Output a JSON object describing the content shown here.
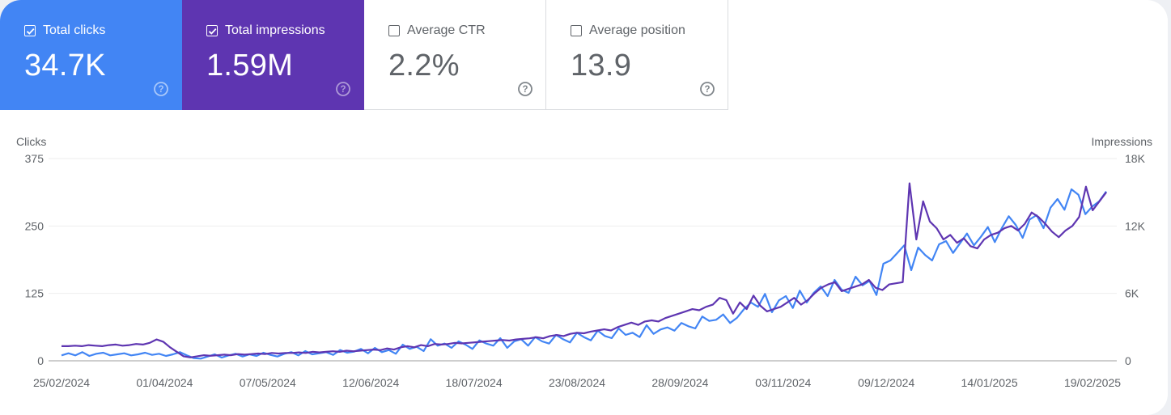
{
  "metrics": [
    {
      "label": "Total clicks",
      "value": "34.7K",
      "checked": true,
      "color": "#4285f4",
      "help_icon": "help-circle-icon"
    },
    {
      "label": "Total impressions",
      "value": "1.59M",
      "checked": true,
      "color": "#5e35b1",
      "help_icon": "help-circle-icon"
    },
    {
      "label": "Average CTR",
      "value": "2.2%",
      "checked": false,
      "color": "#ffffff",
      "help_icon": "help-circle-icon"
    },
    {
      "label": "Average position",
      "value": "13.9",
      "checked": false,
      "color": "#ffffff",
      "help_icon": "help-circle-icon"
    }
  ],
  "chart_data": {
    "type": "line",
    "title": "",
    "left_axis_label": "Clicks",
    "right_axis_label": "Impressions",
    "left_ylim": [
      0,
      375
    ],
    "right_ylim": [
      0,
      18000
    ],
    "left_ticks": [
      "0",
      "125",
      "250",
      "375"
    ],
    "right_ticks": [
      "0",
      "6K",
      "12K",
      "18K"
    ],
    "x_ticks": [
      "25/02/2024",
      "01/04/2024",
      "07/05/2024",
      "12/06/2024",
      "18/07/2024",
      "23/08/2024",
      "28/09/2024",
      "03/11/2024",
      "09/12/2024",
      "14/01/2025",
      "19/02/2025"
    ],
    "x_range": [
      "25/02/2024",
      "24/02/2025"
    ],
    "grid": true,
    "legend": "none",
    "series": [
      {
        "name": "Clicks",
        "axis": "left",
        "color": "#4285f4",
        "values": [
          10,
          14,
          10,
          16,
          9,
          13,
          15,
          10,
          12,
          14,
          10,
          12,
          15,
          11,
          13,
          9,
          12,
          16,
          10,
          5,
          4,
          8,
          12,
          6,
          10,
          13,
          8,
          12,
          9,
          15,
          11,
          8,
          13,
          16,
          10,
          18,
          12,
          14,
          16,
          11,
          20,
          15,
          17,
          22,
          14,
          24,
          16,
          20,
          13,
          30,
          22,
          26,
          18,
          40,
          28,
          32,
          24,
          36,
          30,
          22,
          38,
          32,
          28,
          42,
          24,
          36,
          40,
          28,
          44,
          36,
          32,
          48,
          40,
          34,
          52,
          44,
          38,
          56,
          46,
          42,
          60,
          48,
          52,
          44,
          66,
          50,
          58,
          62,
          56,
          70,
          64,
          60,
          82,
          74,
          76,
          86,
          70,
          80,
          96,
          108,
          100,
          124,
          90,
          112,
          120,
          98,
          130,
          108,
          126,
          138,
          120,
          150,
          132,
          126,
          156,
          140,
          148,
          122,
          180,
          186,
          200,
          214,
          168,
          210,
          196,
          186,
          216,
          222,
          200,
          218,
          236,
          214,
          230,
          248,
          220,
          246,
          268,
          252,
          228,
          262,
          270,
          246,
          284,
          300,
          280,
          318,
          308,
          272,
          286,
          296,
          314
        ],
        "sampling": "approximately every 2.5 days from 25/02/2024"
      },
      {
        "name": "Impressions",
        "axis": "right",
        "color": "#5e35b1",
        "values": [
          1300,
          1300,
          1350,
          1300,
          1400,
          1350,
          1300,
          1400,
          1450,
          1350,
          1400,
          1500,
          1450,
          1600,
          1900,
          1700,
          1200,
          800,
          400,
          300,
          400,
          500,
          450,
          500,
          550,
          500,
          600,
          550,
          600,
          650,
          600,
          700,
          650,
          700,
          700,
          750,
          700,
          800,
          750,
          800,
          850,
          800,
          900,
          850,
          900,
          950,
          1000,
          950,
          1100,
          1000,
          1200,
          1300,
          1200,
          1400,
          1300,
          1500,
          1450,
          1500,
          1600,
          1550,
          1600,
          1650,
          1700,
          1750,
          1800,
          1850,
          1800,
          1900,
          1950,
          2000,
          2100,
          2000,
          2200,
          2300,
          2200,
          2400,
          2500,
          2450,
          2600,
          2700,
          2800,
          2700,
          3000,
          3200,
          3400,
          3200,
          3500,
          3600,
          3500,
          3800,
          4000,
          4200,
          4400,
          4600,
          4500,
          4800,
          5000,
          5600,
          5400,
          4200,
          5200,
          4600,
          5800,
          4900,
          4400,
          4600,
          4800,
          5200,
          5600,
          5000,
          5400,
          6000,
          6500,
          6800,
          7000,
          6200,
          6400,
          6600,
          6800,
          7200,
          6500,
          6300,
          6800,
          6900,
          7000,
          15800,
          10800,
          14200,
          12400,
          11800,
          10800,
          11200,
          10500,
          10900,
          10200,
          10000,
          10800,
          11200,
          11400,
          11800,
          12000,
          11600,
          12200,
          13200,
          12800,
          12200,
          11500,
          11000,
          11600,
          12000,
          12800,
          15500,
          13400,
          14200,
          15000
        ]
      }
    ]
  }
}
